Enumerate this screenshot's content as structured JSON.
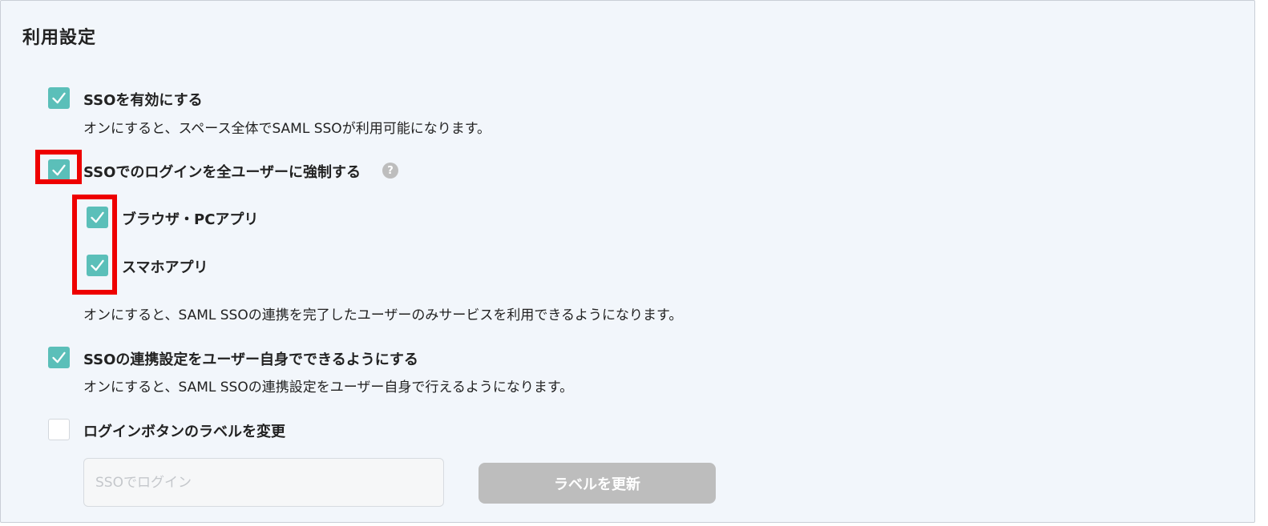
{
  "page": {
    "title": "利用設定"
  },
  "colors": {
    "checkbox_checked": "#5bbfb9",
    "highlight": "#ee0000",
    "button_disabled": "#bdbdbd"
  },
  "settings": {
    "enable_sso": {
      "label": "SSOを有効にする",
      "checked": true,
      "description": "オンにすると、スペース全体でSAML SSOが利用可能になります。"
    },
    "force_sso": {
      "label": "SSOでのログインを全ユーザーに強制する",
      "checked": true,
      "help_icon": "?",
      "description": "オンにすると、SAML SSOの連携を完了したユーザーのみサービスを利用できるようになります。",
      "options": [
        {
          "label": "ブラウザ・PCアプリ",
          "checked": true
        },
        {
          "label": "スマホアプリ",
          "checked": true
        }
      ]
    },
    "self_link": {
      "label": "SSOの連携設定をユーザー自身でできるようにする",
      "checked": true,
      "description": "オンにすると、SAML SSOの連携設定をユーザー自身で行えるようになります。"
    },
    "login_label": {
      "label": "ログインボタンのラベルを変更",
      "checked": false,
      "input_placeholder": "SSOでログイン",
      "input_value": "",
      "update_button": "ラベルを更新"
    }
  }
}
